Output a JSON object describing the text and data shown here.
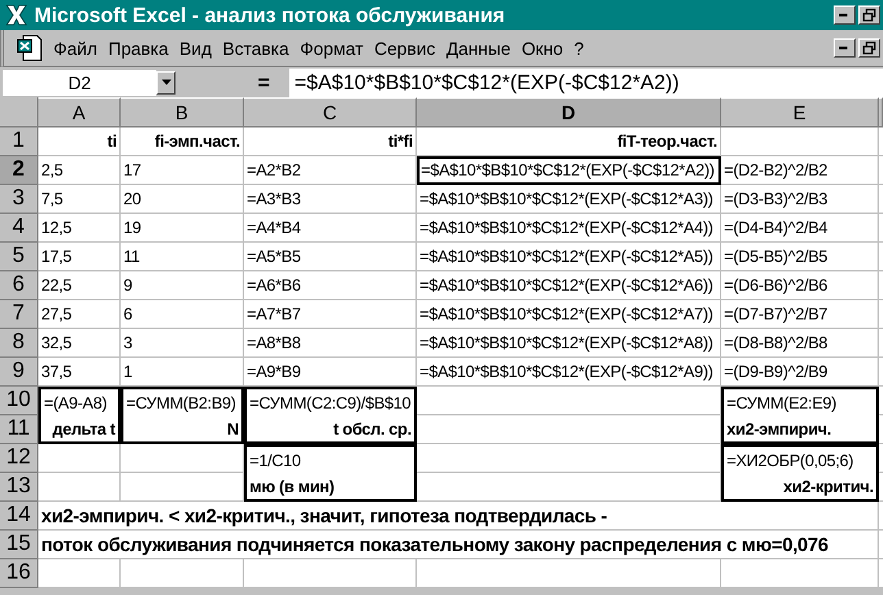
{
  "window": {
    "title": "Microsoft Excel - анализ потока обслуживания"
  },
  "menu": [
    "Файл",
    "Правка",
    "Вид",
    "Вставка",
    "Формат",
    "Сервис",
    "Данные",
    "Окно",
    "?"
  ],
  "formula_bar": {
    "name_box": "D2",
    "equals": "=",
    "formula": "=$A$10*$B$10*$C$12*(EXP(-$C$12*A2))"
  },
  "columns": [
    {
      "label": "A",
      "selected": false
    },
    {
      "label": "B",
      "selected": false
    },
    {
      "label": "C",
      "selected": false
    },
    {
      "label": "D",
      "selected": true
    },
    {
      "label": "E",
      "selected": false
    }
  ],
  "rows": [
    {
      "label": "1",
      "selected": false,
      "cells": [
        {
          "text": "ti",
          "kind": "heading",
          "selected": false,
          "framed": false
        },
        {
          "text": "fi-эмп.част.",
          "kind": "heading",
          "selected": false,
          "framed": false
        },
        {
          "text": "ti*fi",
          "kind": "heading",
          "selected": false,
          "framed": false
        },
        {
          "text": "fiT-теор.част.",
          "kind": "heading",
          "selected": false,
          "framed": false
        },
        {
          "selected": false,
          "framed": false
        }
      ]
    },
    {
      "label": "2",
      "selected": true,
      "cells": [
        {
          "text": "2,5",
          "kind": "value",
          "selected": false,
          "framed": false
        },
        {
          "text": "17",
          "kind": "value",
          "selected": false,
          "framed": false
        },
        {
          "text": "=A2*B2",
          "kind": "value",
          "selected": false,
          "framed": false
        },
        {
          "text": "=$A$10*$B$10*$C$12*(EXP(-$C$12*A2))",
          "kind": "value",
          "selected": true,
          "framed": false
        },
        {
          "text": "=(D2-B2)^2/B2",
          "kind": "value",
          "selected": false,
          "framed": false
        }
      ]
    },
    {
      "label": "3",
      "selected": false,
      "cells": [
        {
          "text": "7,5",
          "kind": "value",
          "selected": false,
          "framed": false
        },
        {
          "text": "20",
          "kind": "value",
          "selected": false,
          "framed": false
        },
        {
          "text": "=A3*B3",
          "kind": "value",
          "selected": false,
          "framed": false
        },
        {
          "text": "=$A$10*$B$10*$C$12*(EXP(-$C$12*A3))",
          "kind": "value",
          "selected": false,
          "framed": false
        },
        {
          "text": "=(D3-B3)^2/B3",
          "kind": "value",
          "selected": false,
          "framed": false
        }
      ]
    },
    {
      "label": "4",
      "selected": false,
      "cells": [
        {
          "text": "12,5",
          "kind": "value",
          "selected": false,
          "framed": false
        },
        {
          "text": "19",
          "kind": "value",
          "selected": false,
          "framed": false
        },
        {
          "text": "=A4*B4",
          "kind": "value",
          "selected": false,
          "framed": false
        },
        {
          "text": "=$A$10*$B$10*$C$12*(EXP(-$C$12*A4))",
          "kind": "value",
          "selected": false,
          "framed": false
        },
        {
          "text": "=(D4-B4)^2/B4",
          "kind": "value",
          "selected": false,
          "framed": false
        }
      ]
    },
    {
      "label": "5",
      "selected": false,
      "cells": [
        {
          "text": "17,5",
          "kind": "value",
          "selected": false,
          "framed": false
        },
        {
          "text": "11",
          "kind": "value",
          "selected": false,
          "framed": false
        },
        {
          "text": "=A5*B5",
          "kind": "value",
          "selected": false,
          "framed": false
        },
        {
          "text": "=$A$10*$B$10*$C$12*(EXP(-$C$12*A5))",
          "kind": "value",
          "selected": false,
          "framed": false
        },
        {
          "text": "=(D5-B5)^2/B5",
          "kind": "value",
          "selected": false,
          "framed": false
        }
      ]
    },
    {
      "label": "6",
      "selected": false,
      "cells": [
        {
          "text": "22,5",
          "kind": "value",
          "selected": false,
          "framed": false
        },
        {
          "text": "9",
          "kind": "value",
          "selected": false,
          "framed": false
        },
        {
          "text": "=A6*B6",
          "kind": "value",
          "selected": false,
          "framed": false
        },
        {
          "text": "=$A$10*$B$10*$C$12*(EXP(-$C$12*A6))",
          "kind": "value",
          "selected": false,
          "framed": false
        },
        {
          "text": "=(D6-B6)^2/B6",
          "kind": "value",
          "selected": false,
          "framed": false
        }
      ]
    },
    {
      "label": "7",
      "selected": false,
      "cells": [
        {
          "text": "27,5",
          "kind": "value",
          "selected": false,
          "framed": false
        },
        {
          "text": "6",
          "kind": "value",
          "selected": false,
          "framed": false
        },
        {
          "text": "=A7*B7",
          "kind": "value",
          "selected": false,
          "framed": false
        },
        {
          "text": "=$A$10*$B$10*$C$12*(EXP(-$C$12*A7))",
          "kind": "value",
          "selected": false,
          "framed": false
        },
        {
          "text": "=(D7-B7)^2/B7",
          "kind": "value",
          "selected": false,
          "framed": false
        }
      ]
    },
    {
      "label": "8",
      "selected": false,
      "cells": [
        {
          "text": "32,5",
          "kind": "value",
          "selected": false,
          "framed": false
        },
        {
          "text": "3",
          "kind": "value",
          "selected": false,
          "framed": false
        },
        {
          "text": "=A8*B8",
          "kind": "value",
          "selected": false,
          "framed": false
        },
        {
          "text": "=$A$10*$B$10*$C$12*(EXP(-$C$12*A8))",
          "kind": "value",
          "selected": false,
          "framed": false
        },
        {
          "text": "=(D8-B8)^2/B8",
          "kind": "value",
          "selected": false,
          "framed": false
        }
      ]
    },
    {
      "label": "9",
      "selected": false,
      "cells": [
        {
          "text": "37,5",
          "kind": "value",
          "selected": false,
          "framed": false
        },
        {
          "text": "1",
          "kind": "value",
          "selected": false,
          "framed": false
        },
        {
          "text": "=A9*B9",
          "kind": "value",
          "selected": false,
          "framed": false
        },
        {
          "text": "=$A$10*$B$10*$C$12*(EXP(-$C$12*A9))",
          "kind": "value",
          "selected": false,
          "framed": false
        },
        {
          "text": "=(D9-B9)^2/B9",
          "kind": "value",
          "selected": false,
          "framed": false
        }
      ]
    },
    {
      "label": "10",
      "selected": false,
      "cells": [
        {
          "text": "=(A9-A8)",
          "kind": "value",
          "selected": false,
          "framed": true
        },
        {
          "text": "=СУММ(B2:B9)",
          "kind": "value",
          "selected": false,
          "framed": true
        },
        {
          "text": "=СУММ(C2:C9)/$B$10",
          "kind": "value",
          "selected": false,
          "framed": true
        },
        {
          "selected": false,
          "framed": false
        },
        {
          "text": "=СУММ(E2:E9)",
          "kind": "value",
          "selected": false,
          "framed": true
        }
      ]
    },
    {
      "label": "11",
      "selected": false,
      "cells": [
        {
          "text": "дельта t",
          "kind": "heading",
          "selected": false,
          "framed": true
        },
        {
          "text": "N",
          "kind": "heading",
          "selected": false,
          "framed": true
        },
        {
          "text": "t обсл. ср.",
          "kind": "heading",
          "selected": false,
          "framed": true
        },
        {
          "selected": false,
          "framed": false
        },
        {
          "text": "хи2-эмпирич.",
          "kind": "note",
          "selected": false,
          "framed": true
        }
      ]
    },
    {
      "label": "12",
      "selected": false,
      "cells": [
        {
          "selected": false,
          "framed": false
        },
        {
          "selected": false,
          "framed": false
        },
        {
          "text": "=1/C10",
          "kind": "value",
          "selected": false,
          "framed": true
        },
        {
          "selected": false,
          "framed": false
        },
        {
          "text": "=ХИ2ОБР(0,05;6)",
          "kind": "value",
          "selected": false,
          "framed": true
        }
      ]
    },
    {
      "label": "13",
      "selected": false,
      "cells": [
        {
          "selected": false,
          "framed": false
        },
        {
          "selected": false,
          "framed": false
        },
        {
          "text": "мю (в мин)",
          "kind": "note",
          "selected": false,
          "framed": true
        },
        {
          "selected": false,
          "framed": false
        },
        {
          "text": "хи2-критич.",
          "kind": "heading",
          "selected": false,
          "framed": true
        }
      ]
    },
    {
      "label": "14",
      "selected": false,
      "cells": [
        {
          "text": "хи2-эмпирич. < хи2-критич., значит, гипотеза подтвердилась -",
          "kind": "sentence",
          "selected": false,
          "framed": false
        }
      ]
    },
    {
      "label": "15",
      "selected": false,
      "cells": [
        {
          "text": "поток обслуживания подчиняется показательному закону распределения с мю=0,076",
          "kind": "sentence",
          "selected": false,
          "framed": false
        }
      ]
    },
    {
      "label": "16",
      "selected": false,
      "cells": [
        {
          "selected": false,
          "framed": false
        },
        {
          "selected": false,
          "framed": false
        },
        {
          "selected": false,
          "framed": false
        },
        {
          "selected": false,
          "framed": false
        },
        {
          "selected": false,
          "framed": false
        }
      ]
    }
  ]
}
